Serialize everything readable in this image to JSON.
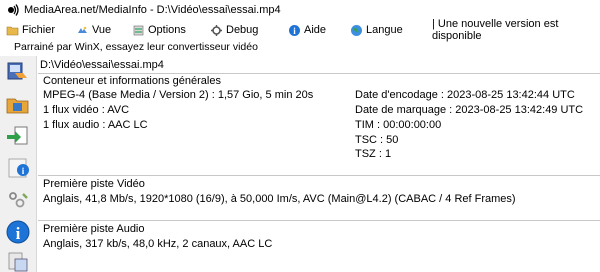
{
  "window": {
    "title": "MediaArea.net/MediaInfo - D:\\Vidéo\\essai\\essai.mp4"
  },
  "menu": {
    "items": [
      {
        "label": "Fichier",
        "icon": "folder-icon"
      },
      {
        "label": "Vue",
        "icon": "view-icon"
      },
      {
        "label": "Options",
        "icon": "options-icon"
      },
      {
        "label": "Debug",
        "icon": "debug-icon"
      },
      {
        "label": "Aide",
        "icon": "help-icon"
      },
      {
        "label": "Langue",
        "icon": "language-icon"
      }
    ],
    "update_notice": "| Une nouvelle version est disponible"
  },
  "sponsor": "Parrainé par WinX, essayez leur convertisseur vidéo",
  "file": {
    "path": "D:\\Vidéo\\essai\\essai.mp4"
  },
  "general": {
    "heading": "Conteneur et informations générales",
    "left": [
      "MPEG-4 (Base Media / Version 2) : 1,57 Gio, 5 min 20s",
      "1 flux vidéo : AVC",
      "1 flux audio : AAC LC"
    ],
    "right": [
      "Date d'encodage : 2023-08-25 13:42:44 UTC",
      "Date de marquage : 2023-08-25 13:42:49 UTC",
      "TIM : 00:00:00:00",
      "TSC : 50",
      "TSZ : 1"
    ]
  },
  "video": {
    "heading": "Première piste Vidéo",
    "line": "Anglais, 41,8 Mb/s, 1920*1080 (16/9), à 50,000 Im/s, AVC (Main@L4.2) (CABAC / 4 Ref Frames)"
  },
  "audio": {
    "heading": "Première piste Audio",
    "line": "Anglais, 317 kb/s, 48,0 kHz, 2 canaux, AAC LC"
  },
  "colors": {
    "sidebar_bg": "#f0f0f0",
    "help_blue": "#1e73d6",
    "divider": "#c8c8c8"
  }
}
